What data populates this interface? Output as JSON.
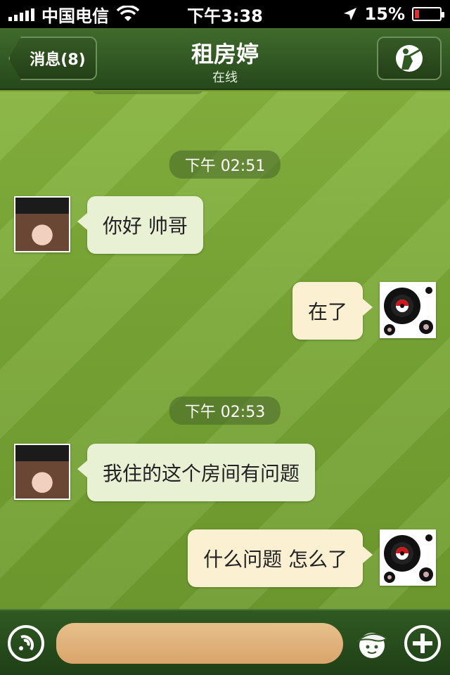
{
  "status_bar": {
    "carrier": "中国电信",
    "time": "下午3:38",
    "battery": "15%"
  },
  "nav": {
    "back_label": "消息(8)",
    "title": "租房婷",
    "subtitle": "在线"
  },
  "chat": {
    "messages": [
      {
        "type": "timestamp",
        "text": "下午 02:51"
      },
      {
        "type": "incoming",
        "text": "你好  帅哥"
      },
      {
        "type": "outgoing",
        "text": "在了"
      },
      {
        "type": "timestamp",
        "text": "下午 02:53"
      },
      {
        "type": "incoming",
        "text": "我住的这个房间有问题"
      },
      {
        "type": "outgoing",
        "text": "什么问题 怎么了"
      }
    ]
  },
  "input_bar": {
    "input_value": "",
    "input_placeholder": ""
  },
  "icons": {
    "signal": "signal-bars-icon",
    "wifi": "wifi-icon",
    "location": "location-arrow-icon",
    "battery": "battery-icon",
    "profile": "golfer-profile-icon",
    "voice": "voice-icon",
    "emoji": "cap-emoji-icon",
    "add": "plus-icon"
  },
  "colors": {
    "nav_green": "#2f5a22",
    "incoming_bubble": "#e9f1d4",
    "outgoing_bubble": "#fbf1d2",
    "battery_low": "#e03030"
  }
}
